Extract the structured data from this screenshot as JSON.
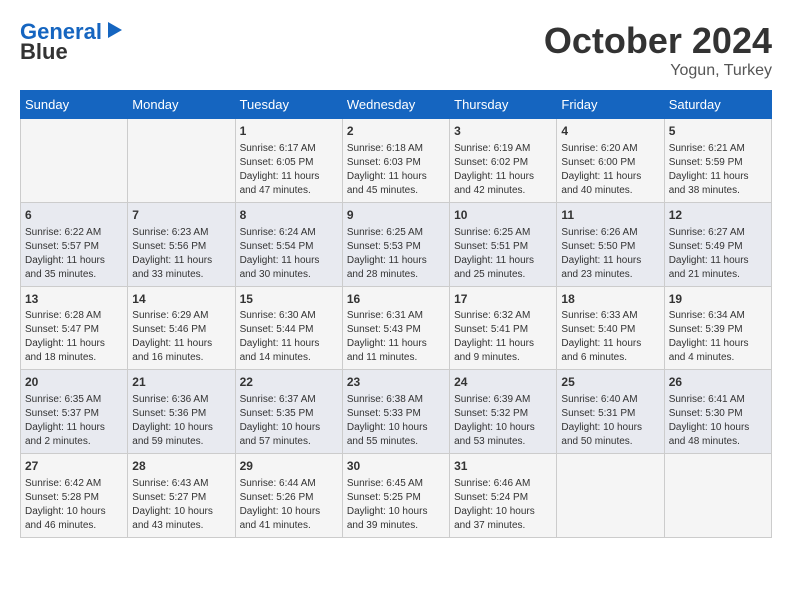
{
  "logo": {
    "line1": "General",
    "line2": "Blue"
  },
  "title": "October 2024",
  "location": "Yogun, Turkey",
  "days_of_week": [
    "Sunday",
    "Monday",
    "Tuesday",
    "Wednesday",
    "Thursday",
    "Friday",
    "Saturday"
  ],
  "weeks": [
    [
      {
        "day": "",
        "info": ""
      },
      {
        "day": "",
        "info": ""
      },
      {
        "day": "1",
        "info": "Sunrise: 6:17 AM\nSunset: 6:05 PM\nDaylight: 11 hours and 47 minutes."
      },
      {
        "day": "2",
        "info": "Sunrise: 6:18 AM\nSunset: 6:03 PM\nDaylight: 11 hours and 45 minutes."
      },
      {
        "day": "3",
        "info": "Sunrise: 6:19 AM\nSunset: 6:02 PM\nDaylight: 11 hours and 42 minutes."
      },
      {
        "day": "4",
        "info": "Sunrise: 6:20 AM\nSunset: 6:00 PM\nDaylight: 11 hours and 40 minutes."
      },
      {
        "day": "5",
        "info": "Sunrise: 6:21 AM\nSunset: 5:59 PM\nDaylight: 11 hours and 38 minutes."
      }
    ],
    [
      {
        "day": "6",
        "info": "Sunrise: 6:22 AM\nSunset: 5:57 PM\nDaylight: 11 hours and 35 minutes."
      },
      {
        "day": "7",
        "info": "Sunrise: 6:23 AM\nSunset: 5:56 PM\nDaylight: 11 hours and 33 minutes."
      },
      {
        "day": "8",
        "info": "Sunrise: 6:24 AM\nSunset: 5:54 PM\nDaylight: 11 hours and 30 minutes."
      },
      {
        "day": "9",
        "info": "Sunrise: 6:25 AM\nSunset: 5:53 PM\nDaylight: 11 hours and 28 minutes."
      },
      {
        "day": "10",
        "info": "Sunrise: 6:25 AM\nSunset: 5:51 PM\nDaylight: 11 hours and 25 minutes."
      },
      {
        "day": "11",
        "info": "Sunrise: 6:26 AM\nSunset: 5:50 PM\nDaylight: 11 hours and 23 minutes."
      },
      {
        "day": "12",
        "info": "Sunrise: 6:27 AM\nSunset: 5:49 PM\nDaylight: 11 hours and 21 minutes."
      }
    ],
    [
      {
        "day": "13",
        "info": "Sunrise: 6:28 AM\nSunset: 5:47 PM\nDaylight: 11 hours and 18 minutes."
      },
      {
        "day": "14",
        "info": "Sunrise: 6:29 AM\nSunset: 5:46 PM\nDaylight: 11 hours and 16 minutes."
      },
      {
        "day": "15",
        "info": "Sunrise: 6:30 AM\nSunset: 5:44 PM\nDaylight: 11 hours and 14 minutes."
      },
      {
        "day": "16",
        "info": "Sunrise: 6:31 AM\nSunset: 5:43 PM\nDaylight: 11 hours and 11 minutes."
      },
      {
        "day": "17",
        "info": "Sunrise: 6:32 AM\nSunset: 5:41 PM\nDaylight: 11 hours and 9 minutes."
      },
      {
        "day": "18",
        "info": "Sunrise: 6:33 AM\nSunset: 5:40 PM\nDaylight: 11 hours and 6 minutes."
      },
      {
        "day": "19",
        "info": "Sunrise: 6:34 AM\nSunset: 5:39 PM\nDaylight: 11 hours and 4 minutes."
      }
    ],
    [
      {
        "day": "20",
        "info": "Sunrise: 6:35 AM\nSunset: 5:37 PM\nDaylight: 11 hours and 2 minutes."
      },
      {
        "day": "21",
        "info": "Sunrise: 6:36 AM\nSunset: 5:36 PM\nDaylight: 10 hours and 59 minutes."
      },
      {
        "day": "22",
        "info": "Sunrise: 6:37 AM\nSunset: 5:35 PM\nDaylight: 10 hours and 57 minutes."
      },
      {
        "day": "23",
        "info": "Sunrise: 6:38 AM\nSunset: 5:33 PM\nDaylight: 10 hours and 55 minutes."
      },
      {
        "day": "24",
        "info": "Sunrise: 6:39 AM\nSunset: 5:32 PM\nDaylight: 10 hours and 53 minutes."
      },
      {
        "day": "25",
        "info": "Sunrise: 6:40 AM\nSunset: 5:31 PM\nDaylight: 10 hours and 50 minutes."
      },
      {
        "day": "26",
        "info": "Sunrise: 6:41 AM\nSunset: 5:30 PM\nDaylight: 10 hours and 48 minutes."
      }
    ],
    [
      {
        "day": "27",
        "info": "Sunrise: 6:42 AM\nSunset: 5:28 PM\nDaylight: 10 hours and 46 minutes."
      },
      {
        "day": "28",
        "info": "Sunrise: 6:43 AM\nSunset: 5:27 PM\nDaylight: 10 hours and 43 minutes."
      },
      {
        "day": "29",
        "info": "Sunrise: 6:44 AM\nSunset: 5:26 PM\nDaylight: 10 hours and 41 minutes."
      },
      {
        "day": "30",
        "info": "Sunrise: 6:45 AM\nSunset: 5:25 PM\nDaylight: 10 hours and 39 minutes."
      },
      {
        "day": "31",
        "info": "Sunrise: 6:46 AM\nSunset: 5:24 PM\nDaylight: 10 hours and 37 minutes."
      },
      {
        "day": "",
        "info": ""
      },
      {
        "day": "",
        "info": ""
      }
    ]
  ]
}
